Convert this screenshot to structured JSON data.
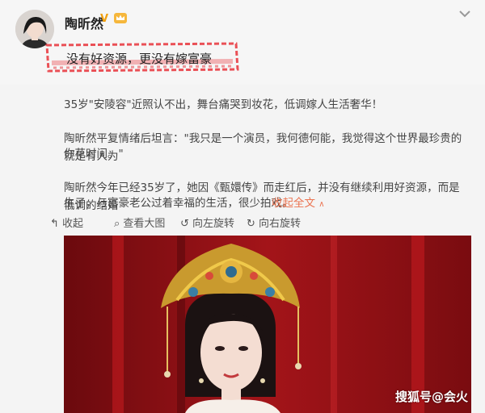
{
  "post": {
    "username": "陶昕然",
    "verified_icon": "v-badge-icon",
    "crown_icon": "crown-badge-icon",
    "menu_icon": "chevron-down-icon",
    "headline": "没有好资源，更没有嫁富豪",
    "paragraphs": [
      "35岁\"安陵容\"近照认不出，舞台痛哭到妆花，低调嫁人生活奢华！",
      "陶昕然平复情绪后坦言：\"我只是一个演员，我何德何能，我觉得这个世界最珍贵的就是有人为",
      "你花时间。\"",
      "陶昕然今年已经35岁了，她因《甄嬛传》而走红后，并没有继续利用好资源，而是低调的结婚",
      "生子，与富豪老公过着幸福的生活，很少拍戏。"
    ],
    "collapse_link": "收起全文",
    "accent_color": "#eb7350"
  },
  "toolbar": {
    "collapse_label": "收起",
    "view_large_label": "查看大图",
    "rotate_left_label": "向左旋转",
    "rotate_right_label": "向右旋转"
  },
  "watermark": "搜狐号@会火"
}
